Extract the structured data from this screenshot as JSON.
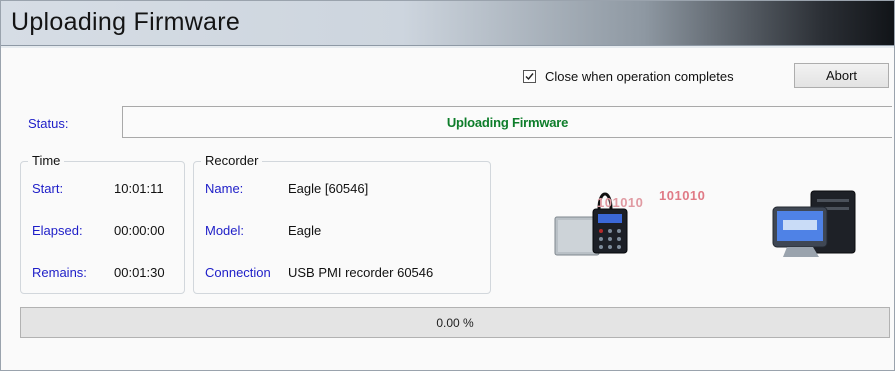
{
  "window": {
    "title": "Uploading Firmware"
  },
  "options": {
    "close_when_complete_label": "Close when operation completes",
    "close_when_complete_checked": true,
    "abort_label": "Abort"
  },
  "status": {
    "label": "Status:",
    "value": "Uploading Firmware"
  },
  "time": {
    "legend": "Time",
    "start_label": "Start:",
    "start_value": "10:01:11",
    "elapsed_label": "Elapsed:",
    "elapsed_value": "00:00:00",
    "remains_label": "Remains:",
    "remains_value": "00:01:30"
  },
  "recorder": {
    "legend": "Recorder",
    "name_label": "Name:",
    "name_value": "Eagle [60546]",
    "model_label": "Model:",
    "model_value": "Eagle",
    "connection_label": "Connection",
    "connection_value": "USB PMI recorder 60546"
  },
  "graphic": {
    "bits_1": "101010",
    "bits_2": "101010",
    "device_icon": "recorder-device-icon",
    "computer_icon": "desktop-computer-icon"
  },
  "progress": {
    "text": "0.00 %",
    "fraction": 0.0
  },
  "colors": {
    "label_blue": "#1e1ec8",
    "status_green": "#0d7d2a"
  }
}
